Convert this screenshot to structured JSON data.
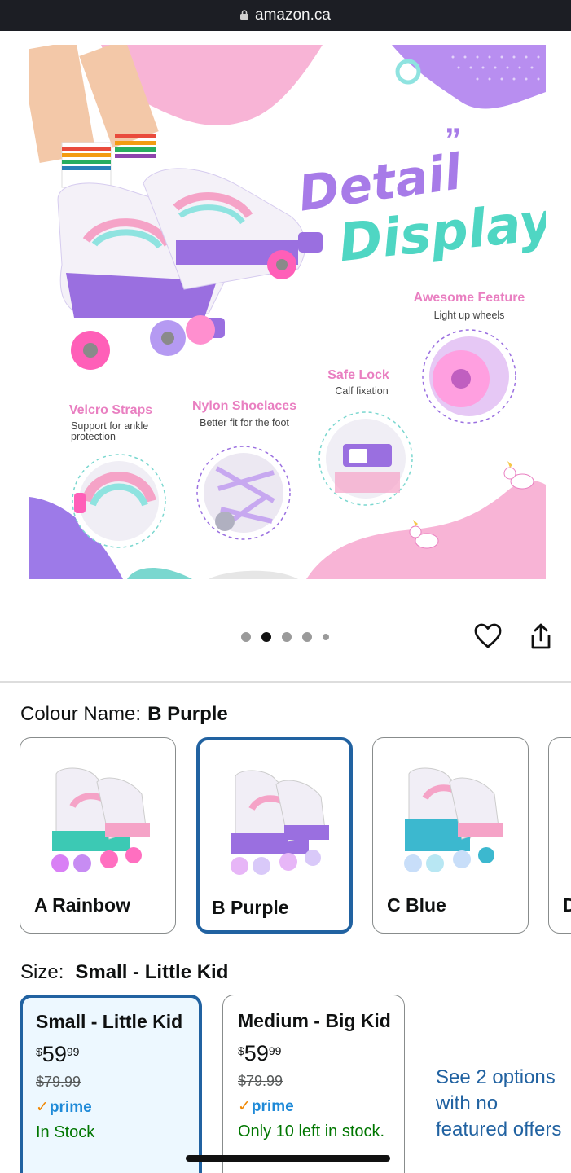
{
  "browser": {
    "url": "amazon.ca"
  },
  "gallery": {
    "image_count": 5,
    "active_index": 1,
    "hero": {
      "title_line1": "Detail",
      "title_line2": "Display",
      "features": [
        {
          "title": "Awesome Feature",
          "subtitle": "Light up wheels"
        },
        {
          "title": "Safe Lock",
          "subtitle": "Calf fixation"
        },
        {
          "title": "Velcro Straps",
          "subtitle": "Support for ankle protection"
        },
        {
          "title": "Nylon Shoelaces",
          "subtitle": "Better fit for the foot"
        }
      ]
    },
    "icons": {
      "wishlist": "heart-icon",
      "share": "share-icon"
    }
  },
  "colour": {
    "label": "Colour Name:",
    "selected": "B Purple",
    "options": [
      {
        "name": "A Rainbow",
        "accent": "#3cc9b4"
      },
      {
        "name": "B Purple",
        "accent": "#9a6fe0"
      },
      {
        "name": "C Blue",
        "accent": "#3cb8cf"
      },
      {
        "name": "D"
      }
    ]
  },
  "size": {
    "label": "Size:",
    "selected": "Small - Little Kid",
    "options": [
      {
        "name": "Small - Little Kid",
        "currency": "$",
        "price_whole": "59",
        "price_fraction": "99",
        "was_price": "$79.99",
        "prime": "prime",
        "stock": "In Stock"
      },
      {
        "name": "Medium - Big Kid",
        "currency": "$",
        "price_whole": "59",
        "price_fraction": "99",
        "was_price": "$79.99",
        "prime": "prime",
        "stock": "Only 10 left in stock."
      }
    ],
    "see_more": "See 2 options with no featured offers"
  },
  "colors": {
    "link": "#2162a1",
    "stock": "#007600",
    "prime": "#1f8ad8",
    "selected_border": "#2162a1"
  }
}
